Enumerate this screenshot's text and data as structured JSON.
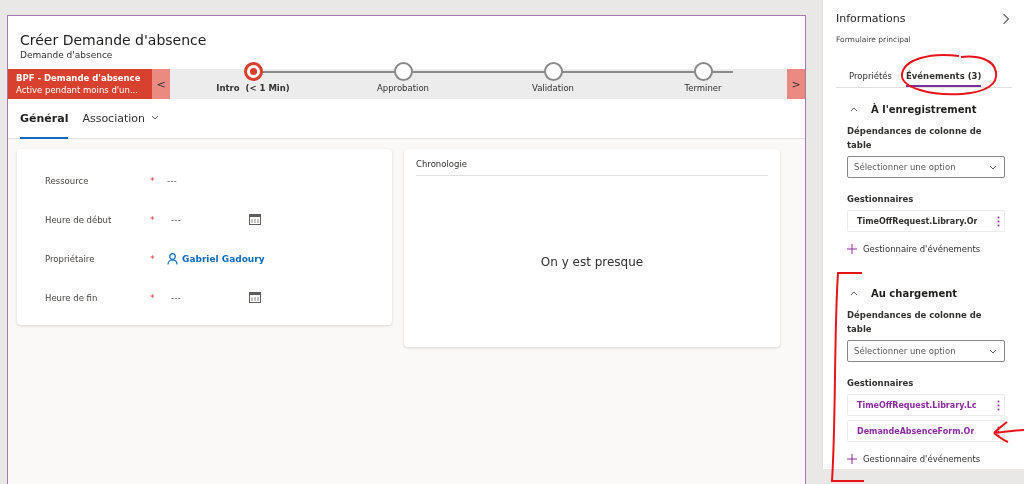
{
  "form": {
    "title": "Créer Demande d'absence",
    "subtitle": "Demande d'absence"
  },
  "process_bar": {
    "name": "BPF - Demande d'absence",
    "status": "Active pendant moins d'un...",
    "prev": "<",
    "next": ">",
    "stages": [
      {
        "label": "Intro  (< 1 Min)",
        "selected": true
      },
      {
        "label": "Approbation",
        "selected": false
      },
      {
        "label": "Validation",
        "selected": false
      },
      {
        "label": "Terminer",
        "selected": false
      }
    ]
  },
  "tabs": [
    {
      "label": "Général",
      "selected": true,
      "has_menu": false
    },
    {
      "label": "Association",
      "selected": false,
      "has_menu": true
    }
  ],
  "fields": [
    {
      "label": "Ressource",
      "required_mark": "*",
      "kind": "text",
      "value": "---"
    },
    {
      "label": "Heure de début",
      "required_mark": "*",
      "kind": "date",
      "value": "---"
    },
    {
      "label": "Propriétaire",
      "required_mark": "*",
      "kind": "lookup",
      "value": "Gabriel Gadoury"
    },
    {
      "label": "Heure de fin",
      "required_mark": "*",
      "kind": "date",
      "value": "---"
    }
  ],
  "timeline": {
    "title": "Chronologie",
    "message": "On y est presque"
  },
  "panel": {
    "title": "Informations",
    "subtitle": "Formulaire principal",
    "tabs": [
      {
        "label": "Propriétés",
        "selected": false
      },
      {
        "label": "Événements (3)",
        "selected": true
      }
    ],
    "sections": [
      {
        "title": "À l'enregistrement",
        "expanded": true,
        "dependencies_label": "Dépendances de colonne de table",
        "select_placeholder": "Sélectionner une option",
        "handlers_label": "Gestionnaires",
        "handlers": [
          {
            "name": "TimeOffRequest.Library.Or",
            "color": "#323130"
          }
        ],
        "add_label": "Gestionnaire d'événements"
      },
      {
        "title": "Au chargement",
        "expanded": true,
        "dependencies_label": "Dépendances de colonne de table",
        "select_placeholder": "Sélectionner une option",
        "handlers_label": "Gestionnaires",
        "handlers": [
          {
            "name": "TimeOffRequest.Library.Lc",
            "color": "#8a2d9e"
          },
          {
            "name": "DemandeAbsenceForm.Or",
            "color": "#8a2d9e"
          }
        ],
        "add_label": "Gestionnaire d'événements"
      }
    ]
  },
  "annotations": [
    {
      "kind": "circle"
    },
    {
      "kind": "bracket"
    },
    {
      "kind": "arrow"
    }
  ]
}
